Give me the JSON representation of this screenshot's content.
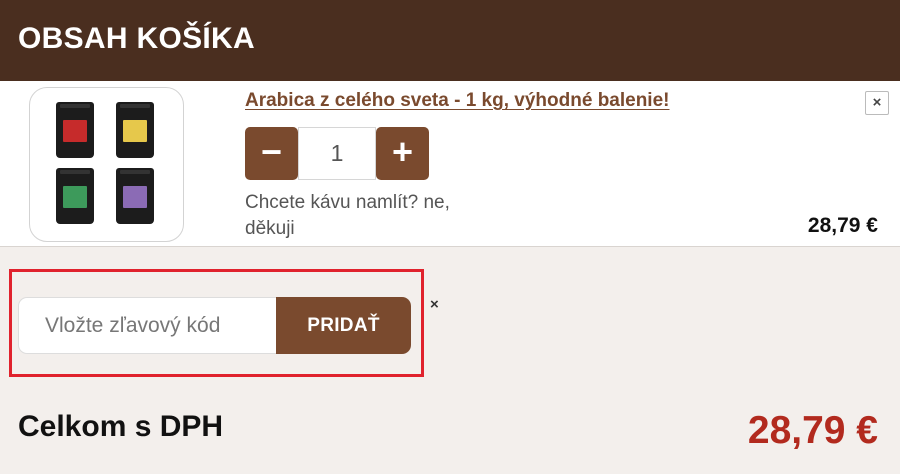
{
  "header": {
    "title": "OBSAH KOŠÍKA"
  },
  "cart_item": {
    "image_icon": "coffee-bags-image",
    "name": "Arabica z celého sveta - 1 kg, výhodné balenie!",
    "remove_label": "×",
    "quantity": "1",
    "minus_label": "−",
    "plus_label": "+",
    "grind_note": "Chcete kávu namlít? ne, děkuji",
    "price": "28,79 €"
  },
  "coupon": {
    "placeholder": "Vložte zľavový kód",
    "button_label": "PRIDAŤ",
    "close_label": "×",
    "highlight_color": "#e0222d"
  },
  "total": {
    "label": "Celkom s DPH",
    "price": "28,79 €"
  },
  "colors": {
    "header_bg": "#4a2e1f",
    "accent_brown": "#7a4a2e",
    "total_red": "#b22a1e"
  }
}
